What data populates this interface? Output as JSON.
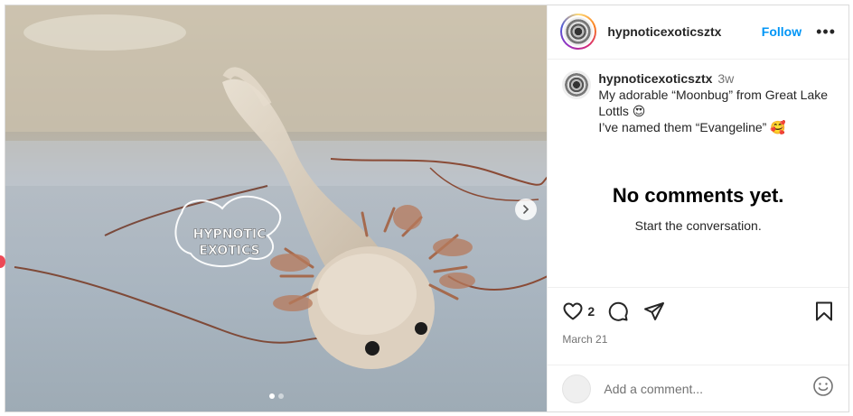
{
  "post": {
    "username": "hypnoticexoticsztx",
    "follow_label": "Follow",
    "more_label": "•••",
    "caption": {
      "username": "hypnoticexoticsztx",
      "time": "3w",
      "line1": "My adorable “Moonbug” from Great Lake Lottls 😍",
      "line2": "I’ve named them “Evangeline” 🥰"
    },
    "empty_comments": {
      "title": "No comments yet.",
      "subtitle": "Start the conversation."
    },
    "likes": "2",
    "date": "March 21",
    "comment_placeholder": "Add a comment..."
  },
  "media": {
    "watermark_line1": "HYPNOTIC",
    "watermark_line2": "EXOTICS",
    "carousel": {
      "total": 2,
      "active": 1
    }
  },
  "icons": {
    "avatar": "avatar-icon",
    "next": "chevron-right-icon",
    "like": "heart-icon",
    "comment": "comment-icon",
    "share": "share-icon",
    "save": "bookmark-icon",
    "emoji": "emoji-icon"
  },
  "colors": {
    "accent": "#0095f6",
    "text": "#262626",
    "muted": "#737373"
  }
}
